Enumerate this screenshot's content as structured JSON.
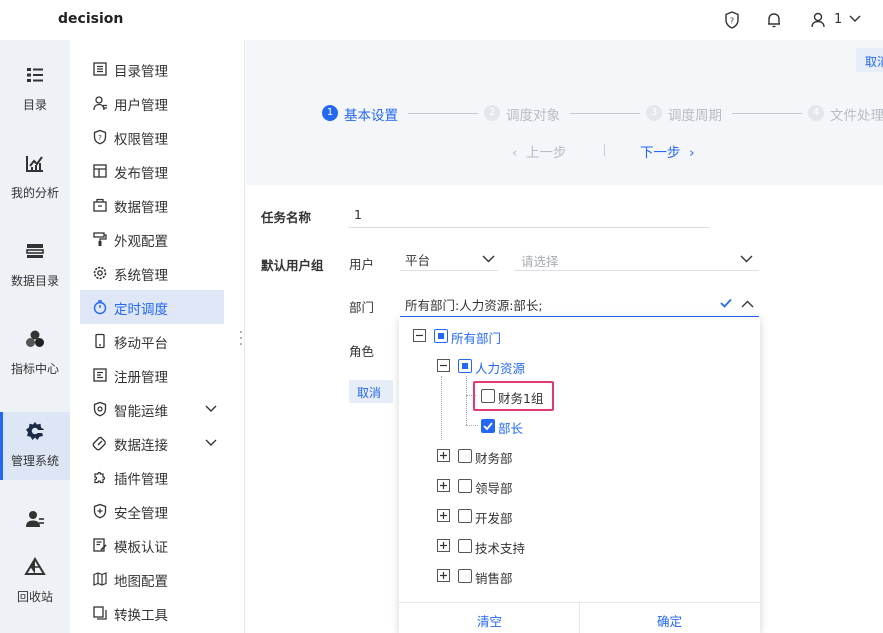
{
  "app": {
    "title": "decision",
    "user": "1"
  },
  "rail": {
    "items": [
      {
        "label": "目录",
        "icon": "list-icon"
      },
      {
        "label": "我的分析",
        "icon": "analysis-chart-icon"
      },
      {
        "label": "数据目录",
        "icon": "data-catalog-icon"
      },
      {
        "label": "指标中心",
        "icon": "indicator-cube-icon"
      },
      {
        "label": "管理系统",
        "icon": "management-gear-icon"
      },
      {
        "label": "",
        "icon": "user-group-icon"
      },
      {
        "label": "回收站",
        "icon": "recycle-drive-icon"
      }
    ]
  },
  "sidebar": {
    "items": [
      {
        "label": "目录管理"
      },
      {
        "label": "用户管理"
      },
      {
        "label": "权限管理"
      },
      {
        "label": "发布管理"
      },
      {
        "label": "数据管理"
      },
      {
        "label": "外观配置"
      },
      {
        "label": "系统管理"
      },
      {
        "label": "定时调度"
      },
      {
        "label": "移动平台"
      },
      {
        "label": "注册管理"
      },
      {
        "label": "智能运维"
      },
      {
        "label": "数据连接"
      },
      {
        "label": "插件管理"
      },
      {
        "label": "安全管理"
      },
      {
        "label": "模板认证"
      },
      {
        "label": "地图配置"
      },
      {
        "label": "转换工具"
      }
    ]
  },
  "wizard": {
    "cancel": "取消",
    "steps": [
      {
        "num": "1",
        "label": "基本设置"
      },
      {
        "num": "2",
        "label": "调度对象"
      },
      {
        "num": "3",
        "label": "调度周期"
      },
      {
        "num": "4",
        "label": "文件处理"
      }
    ],
    "prev": "上一步",
    "next": "下一步"
  },
  "form": {
    "task_name_label": "任务名称",
    "task_name_value": "1",
    "default_user_group_label": "默认用户组",
    "user_label": "用户",
    "platform_value": "平台",
    "user_placeholder": "请选择",
    "dept_label": "部门",
    "dept_value": "所有部门:人力资源:部长;",
    "role_label": "角色",
    "cancel": "取消"
  },
  "tree": {
    "root": "所有部门",
    "hr": "人力资源",
    "finance_group": "财务1组",
    "minister": "部长",
    "others": [
      "财务部",
      "领导部",
      "开发部",
      "技术支持",
      "销售部"
    ]
  },
  "dropdown": {
    "clear": "清空",
    "ok": "确定"
  },
  "colors": {
    "accent": "#2468f2",
    "highlight": "#e03a6f"
  }
}
